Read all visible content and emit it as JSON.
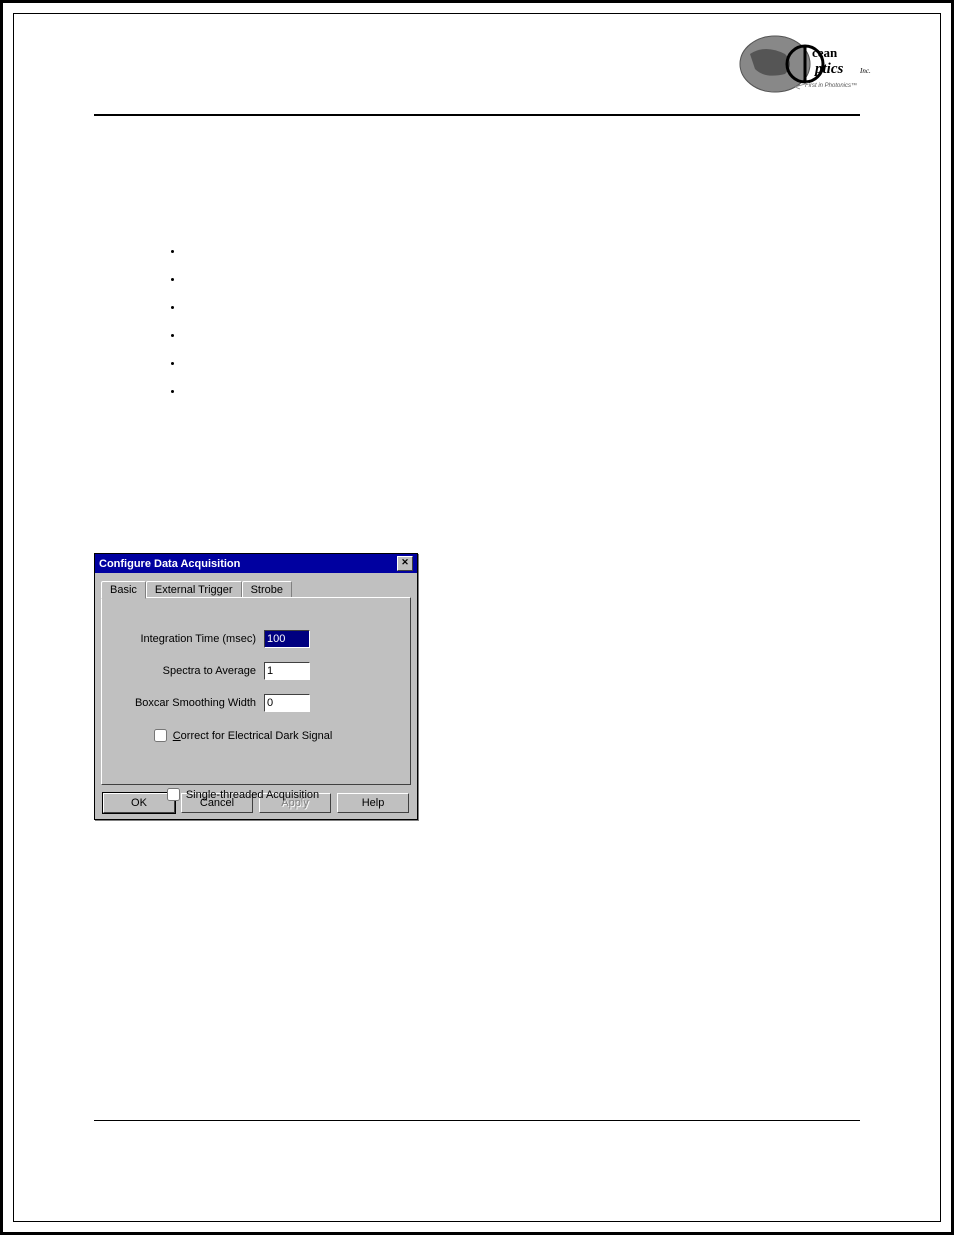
{
  "brand": {
    "name": "Ocean Optics Inc.",
    "tagline": "First in Photonics"
  },
  "dialog": {
    "title": "Configure Data Acquisition",
    "tabs": {
      "basic": "Basic",
      "external_trigger": "External Trigger",
      "strobe": "Strobe"
    },
    "fields": {
      "integration_label": "Integration Time (msec)",
      "integration_value": "100",
      "average_label": "Spectra to Average",
      "average_value": "1",
      "boxcar_label": "Boxcar Smoothing Width",
      "boxcar_value": "0",
      "correct_dark_label": "Correct for Electrical Dark Signal",
      "single_thread_label": "Single-threaded Acquisition"
    },
    "buttons": {
      "ok": "OK",
      "cancel": "Cancel",
      "apply": "Apply",
      "help": "Help"
    }
  }
}
